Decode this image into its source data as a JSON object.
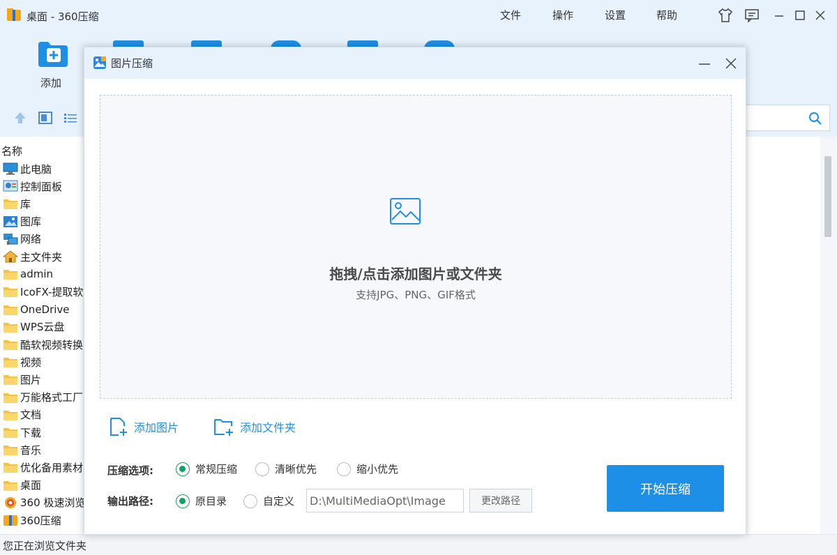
{
  "app": {
    "title": "桌面 - 360压缩",
    "menu": [
      "文件",
      "操作",
      "设置",
      "帮助"
    ]
  },
  "toolbar": {
    "add_label": "添加"
  },
  "filelist": {
    "column_header": "名称",
    "items": [
      {
        "label": "此电脑",
        "icon": "computer-icon"
      },
      {
        "label": "控制面板",
        "icon": "control-panel-icon"
      },
      {
        "label": "库",
        "icon": "folder-icon"
      },
      {
        "label": "图库",
        "icon": "gallery-icon"
      },
      {
        "label": "网络",
        "icon": "network-icon"
      },
      {
        "label": "主文件夹",
        "icon": "home-icon"
      },
      {
        "label": "admin",
        "icon": "folder-icon"
      },
      {
        "label": "IcoFX-提取软",
        "icon": "folder-icon"
      },
      {
        "label": "OneDrive",
        "icon": "folder-icon"
      },
      {
        "label": "WPS云盘",
        "icon": "folder-icon"
      },
      {
        "label": "酷软视频转换",
        "icon": "folder-icon"
      },
      {
        "label": "视频",
        "icon": "folder-icon"
      },
      {
        "label": "图片",
        "icon": "folder-icon"
      },
      {
        "label": "万能格式工厂",
        "icon": "folder-icon"
      },
      {
        "label": "文档",
        "icon": "folder-icon"
      },
      {
        "label": "下载",
        "icon": "folder-icon"
      },
      {
        "label": "音乐",
        "icon": "folder-icon"
      },
      {
        "label": "优化备用素材",
        "icon": "folder-icon"
      },
      {
        "label": "桌面",
        "icon": "folder-icon"
      },
      {
        "label": "360 极速浏览",
        "icon": "browser-icon"
      },
      {
        "label": "360压缩",
        "icon": "archive-icon"
      }
    ]
  },
  "status": {
    "text": "您正在浏览文件夹"
  },
  "dialog": {
    "title": "图片压缩",
    "drop_title": "拖拽/点击添加图片或文件夹",
    "drop_subtitle": "支持JPG、PNG、GIF格式",
    "add_image": "添加图片",
    "add_folder": "添加文件夹",
    "compress_label": "压缩选项:",
    "compress_options": [
      {
        "label": "常规压缩",
        "checked": true
      },
      {
        "label": "清晰优先",
        "checked": false
      },
      {
        "label": "缩小优先",
        "checked": false
      }
    ],
    "output_label": "输出路径:",
    "output_options": [
      {
        "label": "原目录",
        "checked": true
      },
      {
        "label": "自定义",
        "checked": false
      }
    ],
    "path_value": "D:\\MultiMediaOpt\\Image",
    "change_path": "更改路径",
    "start_button": "开始压缩"
  },
  "colors": {
    "accent": "#1e8fe6",
    "radio_checked": "#12a15f",
    "titlebar_bg": "#e8f2fc"
  }
}
